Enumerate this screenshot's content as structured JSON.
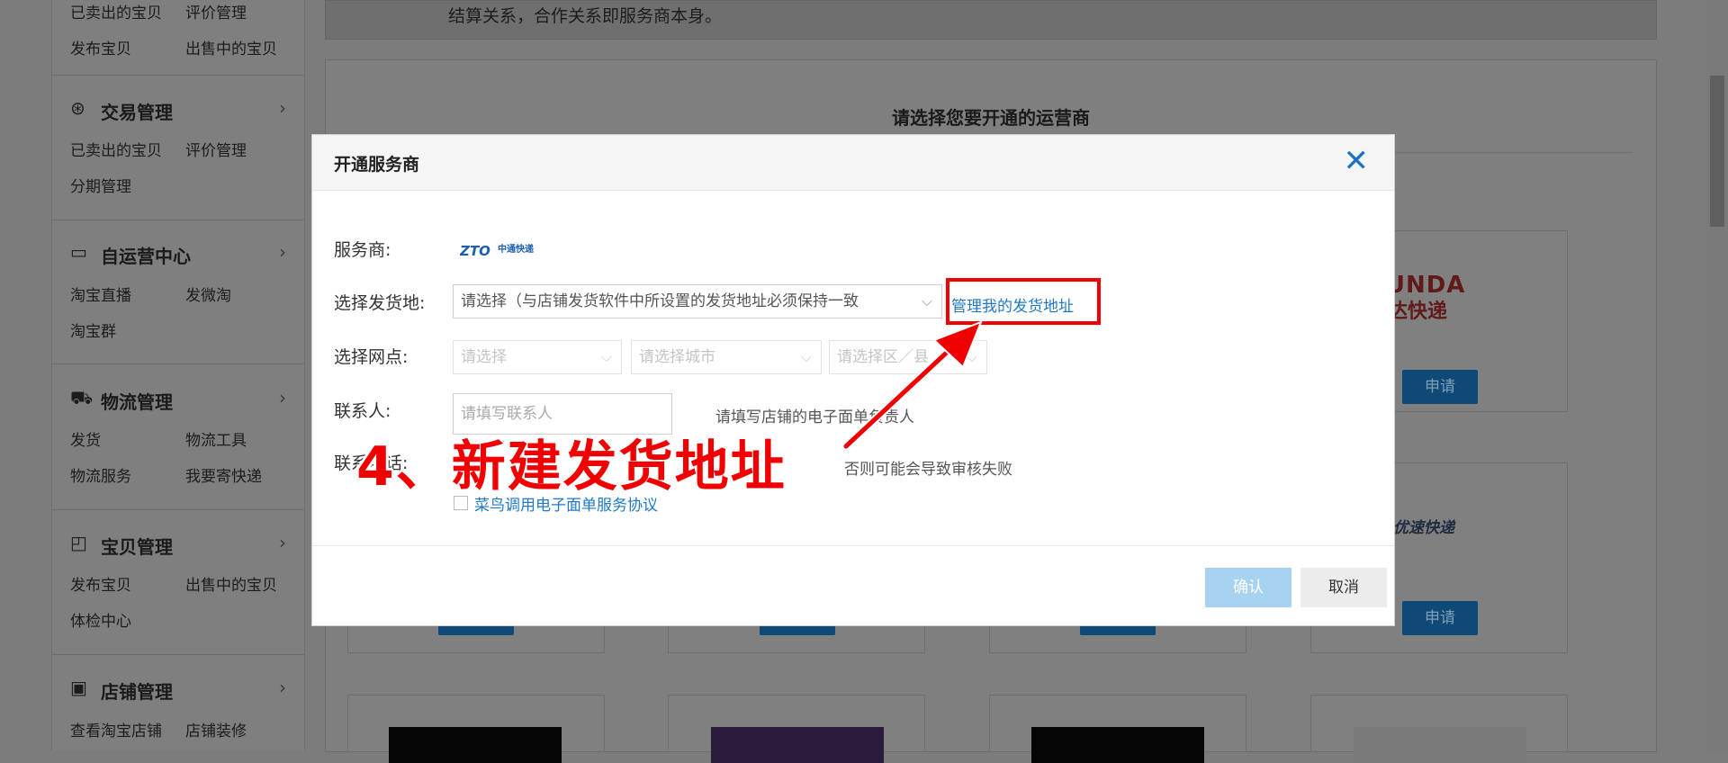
{
  "sidebar": {
    "top_links": [
      {
        "left": "已卖出的宝贝",
        "right": "评价管理"
      },
      {
        "left": "发布宝贝",
        "right": "出售中的宝贝"
      }
    ],
    "sections": [
      {
        "title": "交易管理",
        "icon": "yen-circle-icon",
        "links": [
          {
            "left": "已卖出的宝贝",
            "right": "评价管理"
          },
          {
            "left": "分期管理",
            "right": ""
          }
        ]
      },
      {
        "title": "自运营中心",
        "icon": "chat-bubble-icon",
        "links": [
          {
            "left": "淘宝直播",
            "right": "发微淘"
          },
          {
            "left": "淘宝群",
            "right": ""
          }
        ]
      },
      {
        "title": "物流管理",
        "icon": "truck-icon",
        "links": [
          {
            "left": "发货",
            "right": "物流工具"
          },
          {
            "left": "物流服务",
            "right": "我要寄快递"
          }
        ]
      },
      {
        "title": "宝贝管理",
        "icon": "bag-icon",
        "links": [
          {
            "left": "发布宝贝",
            "right": "出售中的宝贝"
          },
          {
            "left": "体检中心",
            "right": ""
          }
        ]
      },
      {
        "title": "店铺管理",
        "icon": "shop-icon",
        "links": [
          {
            "left": "查看淘宝店铺",
            "right": "店铺装修"
          }
        ]
      }
    ]
  },
  "main": {
    "top_note": "结算关系，合作关系即服务商本身。",
    "panel_title": "请选择您要开通的运营商",
    "apply_label": "申请",
    "logos": {
      "yunda_en": "YUNDA",
      "yunda_cn": "韵达快递",
      "yousu": "优速快递"
    }
  },
  "modal": {
    "title": "开通服务商",
    "close_icon": "close-x-icon",
    "provider_label": "服务商:",
    "provider_logo_text": "ZTO 中通快递",
    "ship_from_label": "选择发货地:",
    "ship_from_value": "请选择（与店铺发货软件中所设置的发货地址必须保持一致",
    "manage_address_link": "管理我的发货地址",
    "branch_label": "选择网点:",
    "branch_selects": [
      "请选择",
      "请选择城市",
      "请选择区／县"
    ],
    "contact_label": "联系人:",
    "contact_placeholder": "请填写联系人",
    "contact_hint": "请填写店铺的电子面单负责人",
    "phone_label": "联系电话:",
    "phone_hint": "否则可能会导致审核失败",
    "agreement_link": "菜鸟调用电子面单服务协议",
    "confirm_label": "确认",
    "cancel_label": "取消"
  },
  "annotation": {
    "text": "4、新建发货地址",
    "color": "#f00000"
  },
  "colors": {
    "link": "#1f79c7",
    "close": "#1b73c7",
    "confirm_disabled": "#a7d3f0",
    "overlay": "#7c7c7c"
  }
}
